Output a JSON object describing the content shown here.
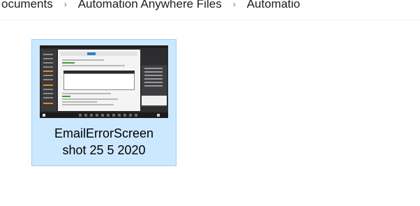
{
  "breadcrumb": {
    "items": [
      "ocuments",
      "Automation Anywhere Files",
      "Automatio"
    ],
    "separator": "›"
  },
  "file": {
    "name_line1": "EmailErrorScreen",
    "name_line2": "shot 25 5 2020",
    "selected": true,
    "icon": "image-thumbnail-icon"
  },
  "colors": {
    "selection_bg": "#cce8ff",
    "selection_border": "#99d1ff"
  }
}
